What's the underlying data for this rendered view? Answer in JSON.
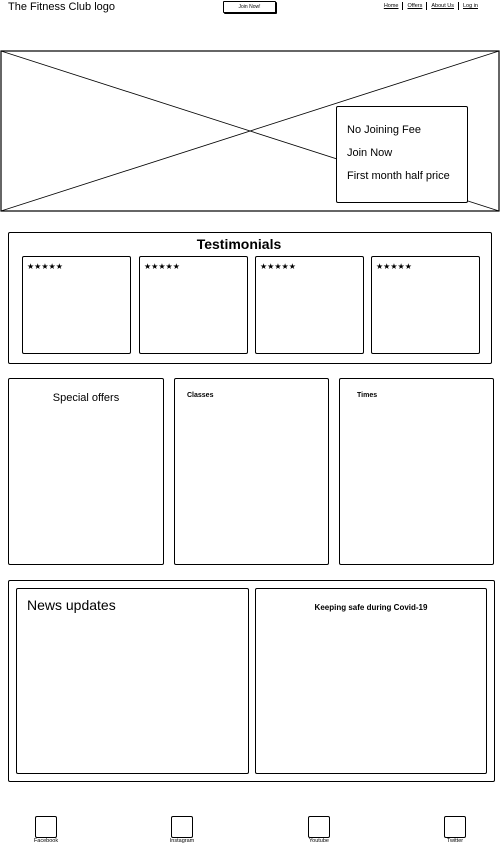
{
  "header": {
    "logo": "The Fitness Club logo",
    "join_button": "Join Now!",
    "nav": [
      "Home",
      "Offers",
      "About Us",
      "Log in"
    ]
  },
  "hero": {
    "promo": [
      "No Joining Fee",
      "Join Now",
      "First month half price"
    ]
  },
  "testimonials": {
    "title": "Testimonials",
    "cards": [
      {
        "stars": "★★★★★"
      },
      {
        "stars": "★★★★★"
      },
      {
        "stars": "★★★★★"
      },
      {
        "stars": "★★★★★"
      }
    ]
  },
  "sections": {
    "offers": "Special offers",
    "classes": "Classes",
    "times": "Times"
  },
  "news": {
    "title": "News updates",
    "covid": "Keeping safe during Covid-19"
  },
  "footer": {
    "social": [
      "Facebook",
      "Instagram",
      "Youtube",
      "Twitter"
    ]
  }
}
